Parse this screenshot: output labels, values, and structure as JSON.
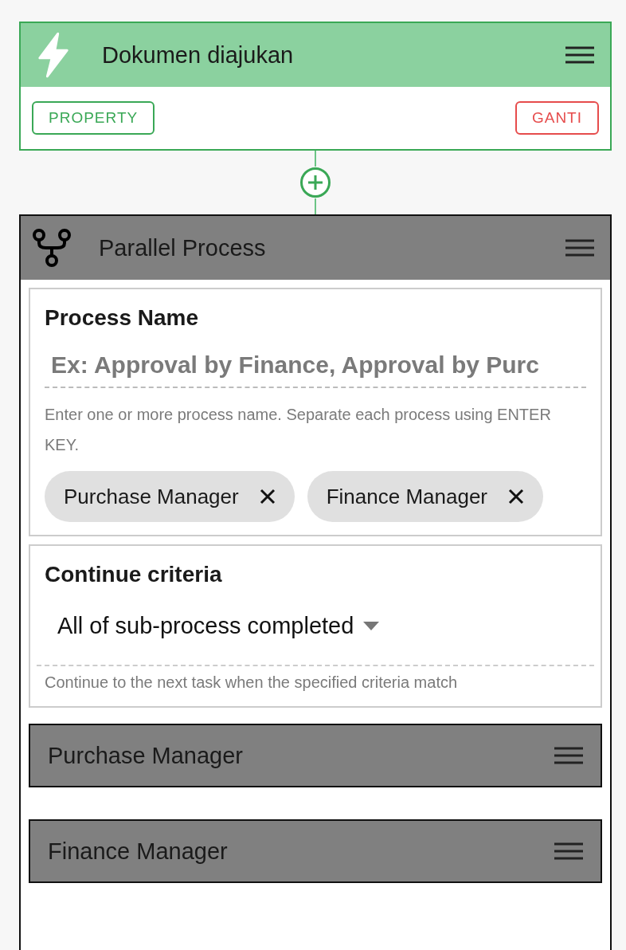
{
  "trigger": {
    "title": "Dokumen diajukan",
    "buttons": [
      {
        "label": "PROPERTY",
        "kind": "primary"
      },
      {
        "label": "GANTI",
        "kind": "danger"
      }
    ]
  },
  "process": {
    "title": "Parallel Process",
    "process_name": {
      "label": "Process Name",
      "placeholder": "Ex: Approval by Finance, Approval by Purc",
      "help": "Enter one or more process name. Separate each process using ENTER KEY.",
      "chips": [
        "Purchase Manager",
        "Finance Manager"
      ]
    },
    "continue_criteria": {
      "label": "Continue criteria",
      "value": "All of sub-process completed",
      "help": "Continue to the next task when the specified criteria match"
    },
    "sub_processes": [
      {
        "title": "Purchase Manager"
      },
      {
        "title": "Finance Manager"
      }
    ]
  }
}
